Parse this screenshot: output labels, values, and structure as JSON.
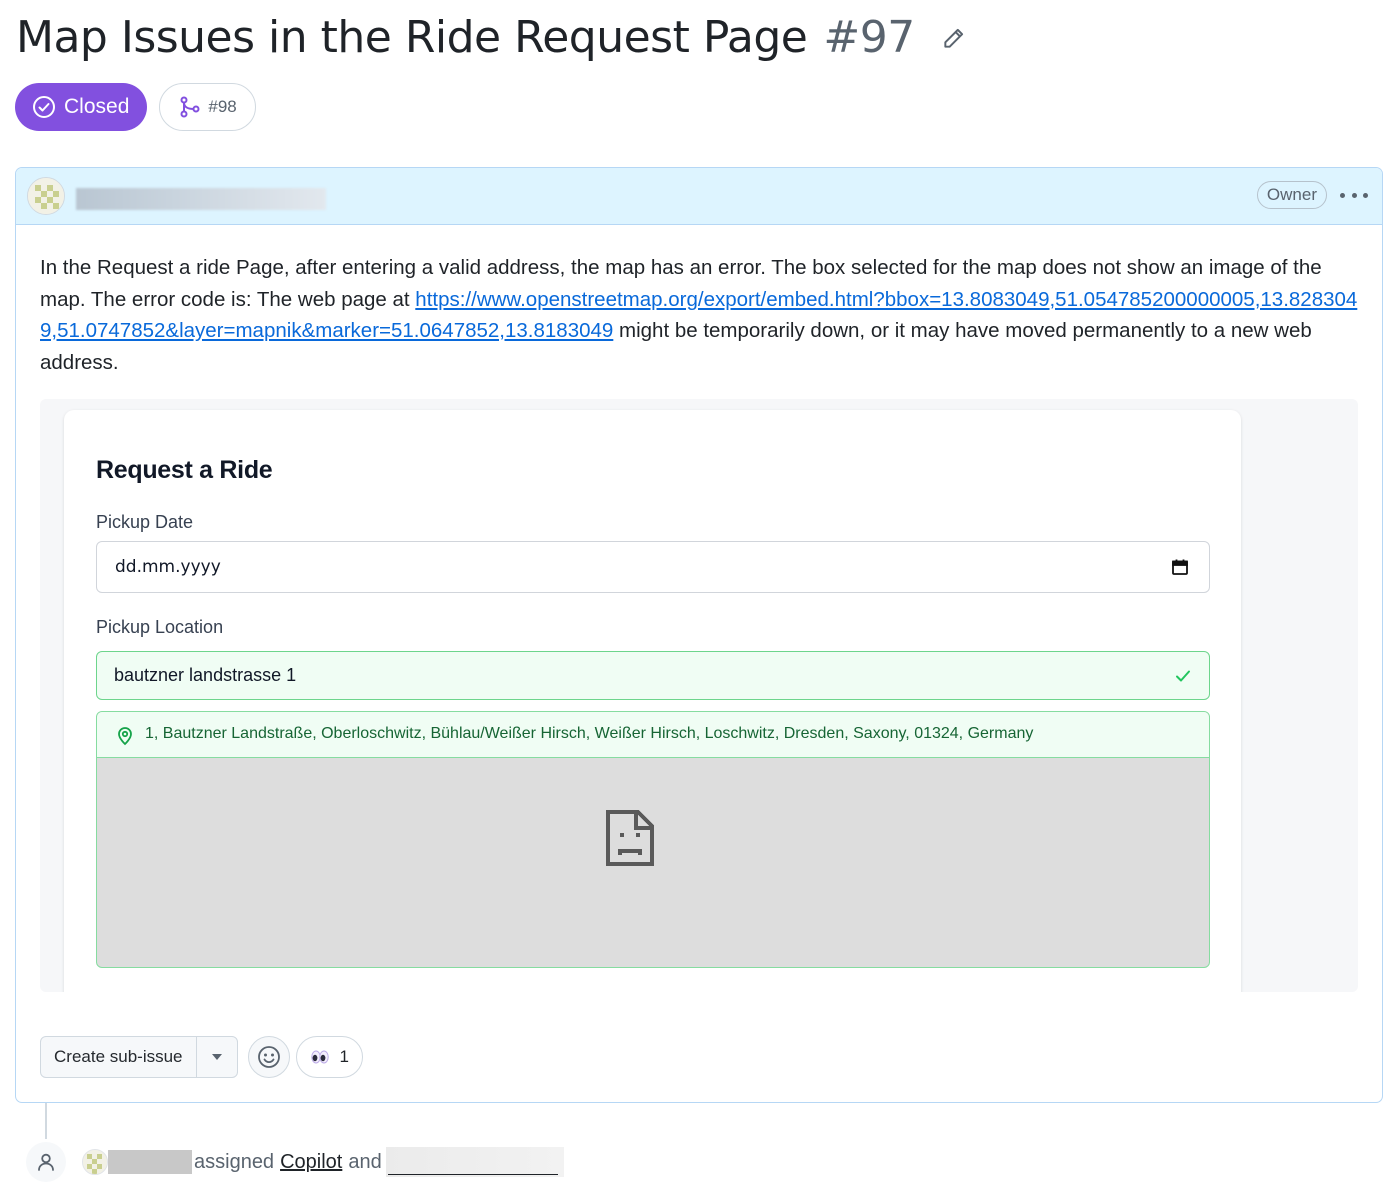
{
  "issue": {
    "title": "Map Issues in the Ride Request Page",
    "number": "#97",
    "state": "Closed",
    "linked_pr": "#98"
  },
  "comment": {
    "role_badge": "Owner",
    "text_before_link": "In the Request a ride Page, after entering a valid address, the map has an error. The box selected for the map does not show an image of the map. The error code is: The web page at ",
    "link": "https://www.openstreetmap.org/export/embed.html?bbox=13.8083049,51.054785200000005,13.8283049,51.0747852&layer=mapnik&marker=51.0647852,13.8183049",
    "text_after_link": " might be temporarily down, or it may have moved permanently to a new web address."
  },
  "screenshot": {
    "title": "Request a Ride",
    "pickup_date_label": "Pickup Date",
    "pickup_date_value": "dd.mm.yyyy",
    "pickup_location_label": "Pickup Location",
    "pickup_location_value": "bautzner landstrasse 1",
    "resolved_address": "1, Bautzner Landstraße, Oberloschwitz, Bühlau/Weißer Hirsch, Weißer Hirsch, Loschwitz, Dresden, Saxony, 01324, Germany"
  },
  "actions": {
    "create_sub_issue": "Create sub-issue",
    "reaction_count": "1"
  },
  "timeline": {
    "assigned": "assigned",
    "assignee": "Copilot",
    "and": "and"
  },
  "colors": {
    "closed_purple": "#8250df",
    "link_blue": "#0969da",
    "header_blue": "#ddf4ff",
    "success_green": "#16a34a"
  },
  "icons": [
    "pencil-icon",
    "check-circle-icon",
    "git-merge-icon",
    "kebab-icon",
    "calendar-icon",
    "check-icon",
    "location-pin-icon",
    "broken-image-icon",
    "triangle-down-icon",
    "smiley-icon",
    "eyes-emoji",
    "person-icon"
  ]
}
